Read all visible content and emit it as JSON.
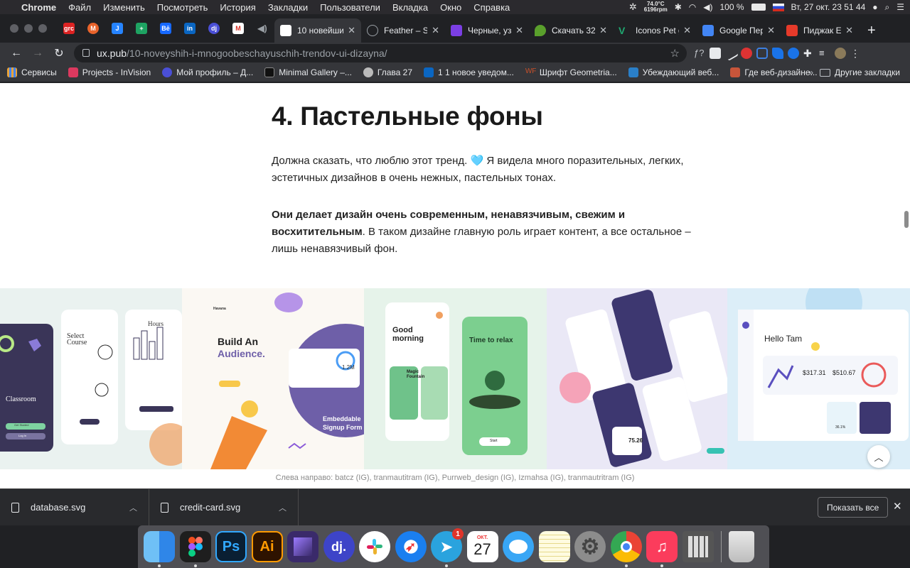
{
  "menubar": {
    "app": "Chrome",
    "items": [
      "Файл",
      "Изменить",
      "Посмотреть",
      "История",
      "Закладки",
      "Пользователи",
      "Вкладка",
      "Окно",
      "Справка"
    ],
    "temp_line1": "74.0°C",
    "temp_line2": "6196rpm",
    "battery": "100 %",
    "datetime": "Вт, 27 окт.  23 51 44"
  },
  "tabs": [
    {
      "title": "10 новейши",
      "color": "#ffffff",
      "active": true
    },
    {
      "title": "Feather – Si",
      "color": "#3a3a3a",
      "active": false
    },
    {
      "title": "Черные, уз",
      "color": "#7b3fe4",
      "active": false
    },
    {
      "title": "Скачать 32",
      "color": "#5aa02c",
      "active": false
    },
    {
      "title": "Iconos Pet g",
      "color": "#1fa971",
      "active": false
    },
    {
      "title": "Google Пер",
      "color": "#4285f4",
      "active": false
    },
    {
      "title": "Пиджак Em",
      "color": "#e63a2a",
      "active": false
    }
  ],
  "toolbar": {
    "url_domain": "ux.pub",
    "url_path": "/10-noveyshih-i-mnogoobeschayuschih-trendov-ui-dizayna/"
  },
  "bookmarks": {
    "items": [
      {
        "label": "Сервисы",
        "color": "#e8a33a"
      },
      {
        "label": "Projects - InVision",
        "color": "#dc395f"
      },
      {
        "label": "Мой профиль – Д...",
        "color": "#4a4fd6"
      },
      {
        "label": "Minimal Gallery –...",
        "color": "#111111"
      },
      {
        "label": "Глава 27",
        "color": "#bbbbbb"
      },
      {
        "label": "1 1 новое уведом...",
        "color": "#0a66c2"
      },
      {
        "label": "Шрифт Geometria...",
        "color": "#c8502a"
      },
      {
        "label": "Убеждающий веб...",
        "color": "#2a7fc8"
      },
      {
        "label": "Где веб-дизайне...",
        "color": "#c8553a"
      }
    ],
    "more": "»",
    "other": "Другие закладки"
  },
  "article": {
    "heading": "4. Пастельные фоны",
    "p1": "Должна сказать, что люблю этот тренд. 🩵 Я видела много поразительных, легких, эстетичных дизайнов в очень нежных, пастельных тонах.",
    "p2_bold": "Они делает дизайн очень современным, ненавязчивым, свежим и восхитительным",
    "p2_rest": ". В таком дизайне главную роль играет контент, а все остальное – лишь ненавязчивый фон.",
    "caption": "Слева направо: batcz (IG), tranmautitram (IG), Purrweb_design (IG), Izmahsa (IG), tranmautritram (IG)"
  },
  "gallery": {
    "s1": {
      "select": "Select",
      "course": "Course",
      "hours": "Hours",
      "classroom": "Classroom",
      "get_started": "Get Started",
      "log_in": "Log In"
    },
    "s2": {
      "brand": "Havana",
      "headline1": "Build An",
      "headline2": "Audience.",
      "stat": "1.2M",
      "embed1": "Embeddable",
      "embed2": "Signup Form"
    },
    "s3": {
      "greet1": "Good",
      "greet2": "morning",
      "relax": "Time to relax",
      "start": "Start",
      "magic1": "Magic",
      "magic2": "Fountain"
    },
    "s4": {
      "score": "75.26"
    },
    "s5": {
      "hello": "Hello Tam",
      "amount1": "$317.31",
      "amount2": "$510.67",
      "pct": "36.1%"
    }
  },
  "downloads": {
    "files": [
      "database.svg",
      "credit-card.svg"
    ],
    "show_all": "Показать все"
  },
  "dock": {
    "apps": [
      {
        "name": "Finder",
        "color": "#2f86e8",
        "glyph": ""
      },
      {
        "name": "Figma",
        "color": "#1e1e1e",
        "glyph": ""
      },
      {
        "name": "Photoshop",
        "color": "#0a1f33",
        "glyph": "Ps"
      },
      {
        "name": "Illustrator",
        "color": "#2e1300",
        "glyph": "Ai"
      },
      {
        "name": "iMovie",
        "color": "#3a2a6a",
        "glyph": ""
      },
      {
        "name": "dj",
        "color": "#3d44c8",
        "glyph": "dj."
      },
      {
        "name": "Slack",
        "color": "#ffffff",
        "glyph": ""
      },
      {
        "name": "Safari",
        "color": "#1a7ff0",
        "glyph": ""
      },
      {
        "name": "Telegram",
        "color": "#2aa3de",
        "glyph": ""
      },
      {
        "name": "Calendar",
        "color": "#ffffff",
        "glyph": "27"
      },
      {
        "name": "Messages",
        "color": "#38a6f5",
        "glyph": ""
      },
      {
        "name": "Notes",
        "color": "#f7e58a",
        "glyph": ""
      },
      {
        "name": "Settings",
        "color": "#8c8c8c",
        "glyph": ""
      },
      {
        "name": "Chrome",
        "color": "#ffffff",
        "glyph": ""
      },
      {
        "name": "Music",
        "color": "#fb3c5c",
        "glyph": ""
      },
      {
        "name": "Calculator",
        "color": "#555555",
        "glyph": ""
      }
    ],
    "telegram_badge": "1",
    "calendar_month": "ОКТ."
  }
}
